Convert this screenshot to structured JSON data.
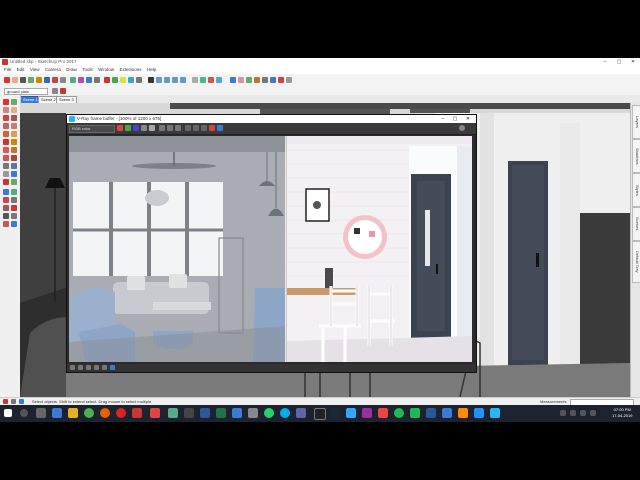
{
  "app": {
    "title": "Untitled.skp - SketchUp Pro 2017",
    "menu": [
      "File",
      "Edit",
      "View",
      "Camera",
      "Draw",
      "Tools",
      "Window",
      "Extensions",
      "Help"
    ],
    "layer_select": "ground plain",
    "scenes": [
      "Scene 1",
      "Scene 2",
      "Scene 3"
    ],
    "right_tabs": [
      "Layers",
      "Shadows",
      "Styles",
      "Scenes",
      "Default Tray"
    ],
    "status_text": "Select objects. Shift to extend select. Drag mouse to select multiple.",
    "measurements_label": "Measurements"
  },
  "vfb": {
    "title": "V-Ray frame buffer - [100% of 1200 x 675]",
    "channel": "RGB color"
  },
  "clock": {
    "time": "07:00 PM",
    "date": "17-04-2019"
  },
  "colors": {
    "taskbar": "#1d2230",
    "scene_active": "#3a7bd5",
    "vfb_bg": "#2b2b2b",
    "render_wall_left": "#9aa0a8",
    "render_wall_right": "#f4f1f4",
    "door": "#3b4250",
    "chair_blue": "#8da5c6",
    "accent_pink": "#f2c2c8"
  },
  "taskbar_icons": [
    "windows-start",
    "search",
    "task-view",
    "chrome",
    "edge",
    "firefox",
    "opera",
    "vray",
    "files",
    "chrome-alt",
    "word",
    "excel",
    "powerpoint",
    "whatsapp",
    "skype",
    "unity",
    "steam",
    "epic",
    "photoshop",
    "spotify",
    "settings",
    "store",
    "sketchup",
    "vray-app"
  ]
}
